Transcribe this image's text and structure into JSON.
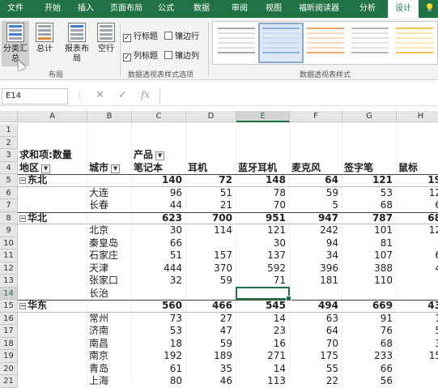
{
  "tabs": [
    "文件",
    "开始",
    "插入",
    "页面布局",
    "公式",
    "数据",
    "审阅",
    "视图",
    "福昕阅读器",
    "分析",
    "设计"
  ],
  "ribbon": {
    "layout_buttons": [
      {
        "label1": "分类汇",
        "label2": "总"
      },
      {
        "label1": "总计",
        "label2": ""
      },
      {
        "label1": "报表布",
        "label2": "局"
      },
      {
        "label1": "空行",
        "label2": ""
      }
    ],
    "layout_group_label": "布局",
    "options": {
      "row_headers": "行标题",
      "col_headers": "列标题",
      "banded_rows": "镶边行",
      "banded_cols": "镶边列"
    },
    "options_group_label": "数据透视表样式选项",
    "styles_group_label": "数据透视表样式"
  },
  "formula_bar": {
    "name_box": "E14",
    "fx": "fx",
    "value": ""
  },
  "columns": [
    "A",
    "B",
    "C",
    "D",
    "E",
    "F",
    "G",
    "H"
  ],
  "selected_column": "E",
  "rows": [
    {
      "n": "1",
      "cells": []
    },
    {
      "n": "2",
      "cells": []
    },
    {
      "n": "3",
      "a": "求和项:数量",
      "c": "产品",
      "c_dd": true
    },
    {
      "n": "4",
      "a": "地区",
      "a_dd": true,
      "b": "城市",
      "b_dd": true,
      "vals": [
        "笔记本",
        "耳机",
        "蓝牙耳机",
        "麦克风",
        "签字笔",
        "鼠标"
      ],
      "bold": true
    },
    {
      "n": "5",
      "a": "东北",
      "minus": true,
      "vals": [
        "140",
        "72",
        "148",
        "64",
        "121",
        "19"
      ],
      "bold": true,
      "sub": true
    },
    {
      "n": "6",
      "b": "大连",
      "vals": [
        "96",
        "51",
        "78",
        "59",
        "53",
        "12"
      ]
    },
    {
      "n": "7",
      "b": "长春",
      "vals": [
        "44",
        "21",
        "70",
        "5",
        "68",
        "6"
      ]
    },
    {
      "n": "8",
      "a": "华北",
      "minus": true,
      "vals": [
        "623",
        "700",
        "951",
        "947",
        "787",
        "68"
      ],
      "bold": true,
      "sub": true
    },
    {
      "n": "9",
      "b": "北京",
      "vals": [
        "30",
        "114",
        "121",
        "242",
        "101",
        "12"
      ]
    },
    {
      "n": "10",
      "b": "秦皇岛",
      "vals": [
        "66",
        "",
        "30",
        "94",
        "81",
        ""
      ]
    },
    {
      "n": "11",
      "b": "石家庄",
      "vals": [
        "51",
        "157",
        "137",
        "34",
        "107",
        "6"
      ]
    },
    {
      "n": "12",
      "b": "天津",
      "vals": [
        "444",
        "370",
        "592",
        "396",
        "388",
        "4"
      ]
    },
    {
      "n": "13",
      "b": "张家口",
      "vals": [
        "32",
        "59",
        "71",
        "181",
        "110",
        ""
      ]
    },
    {
      "n": "14",
      "b": "长治",
      "vals": [
        "",
        "",
        "",
        "",
        "",
        ""
      ]
    },
    {
      "n": "15",
      "a": "华东",
      "minus": true,
      "vals": [
        "560",
        "466",
        "545",
        "494",
        "669",
        "43"
      ],
      "bold": true,
      "sub": true
    },
    {
      "n": "16",
      "b": "常州",
      "vals": [
        "73",
        "27",
        "14",
        "63",
        "91",
        "1"
      ]
    },
    {
      "n": "17",
      "b": "济南",
      "vals": [
        "53",
        "47",
        "23",
        "64",
        "76",
        "5"
      ]
    },
    {
      "n": "18",
      "b": "南昌",
      "vals": [
        "18",
        "59",
        "16",
        "70",
        "68",
        "3"
      ]
    },
    {
      "n": "19",
      "b": "南京",
      "vals": [
        "192",
        "189",
        "271",
        "175",
        "233",
        "15"
      ]
    },
    {
      "n": "20",
      "b": "青岛",
      "vals": [
        "61",
        "35",
        "14",
        "55",
        "66",
        ""
      ]
    },
    {
      "n": "21",
      "b": "上海",
      "vals": [
        "80",
        "46",
        "113",
        "22",
        "56",
        ""
      ]
    }
  ],
  "selected_cell": "E14",
  "colors": {
    "tab_bar": "#217346",
    "selection": "#217346"
  }
}
